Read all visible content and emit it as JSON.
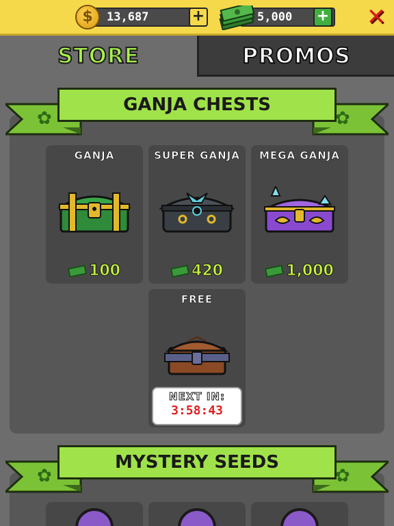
{
  "topbar": {
    "coins": "13,687",
    "coin_symbol": "$",
    "cash": "5,000",
    "coins_plus": "+",
    "cash_plus": "+",
    "close": "✕"
  },
  "tabs": [
    {
      "label": "STORE",
      "active": true
    },
    {
      "label": "PROMOS",
      "active": false
    }
  ],
  "sections": {
    "chests_title": "GANJA CHESTS",
    "seeds_title": "MYSTERY SEEDS"
  },
  "chests": [
    {
      "name": "GANJA",
      "price": "100",
      "color": "#2f8a3a"
    },
    {
      "name": "SUPER GANJA",
      "price": "420",
      "color": "#3a3f45"
    },
    {
      "name": "MEGA GANJA",
      "price": "1,000",
      "color": "#8a4ad0"
    }
  ],
  "free_chest": {
    "name": "FREE",
    "next_label": "NEXT IN:",
    "timer": "3:58:43"
  },
  "colors": {
    "accent_green": "#a0e24a",
    "gold": "#f5d94a",
    "timer_red": "#e02020"
  }
}
